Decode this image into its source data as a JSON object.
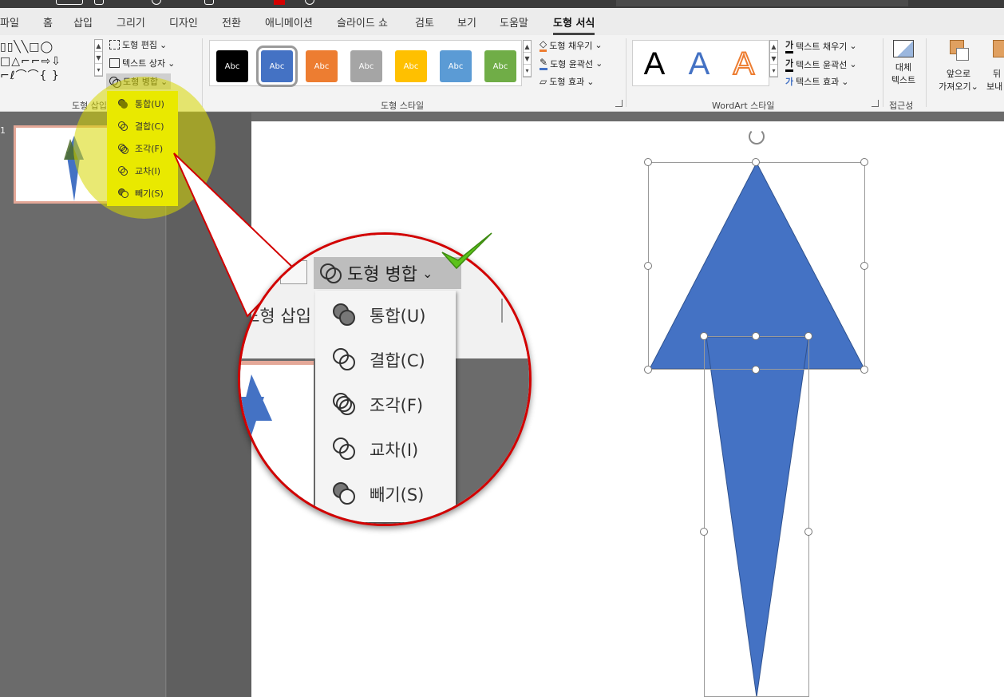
{
  "tabs": [
    "파일",
    "홈",
    "삽입",
    "그리기",
    "디자인",
    "전환",
    "애니메이션",
    "슬라이드 쇼",
    "검토",
    "보기",
    "도움말",
    "도형 서식"
  ],
  "active_tab": "도형 서식",
  "ribbon": {
    "insert_shapes": {
      "label": "도형 삽입",
      "edit_shape": "도형 편집",
      "text_box": "텍스트 상자",
      "merge_shapes": "도형 병합"
    },
    "shape_styles": {
      "label": "도형 스타일",
      "chip_text": "Abc",
      "chip_colors": [
        "#000000",
        "#4472c4",
        "#ed7d31",
        "#a5a5a5",
        "#ffc000",
        "#5b9bd5",
        "#70ad47"
      ],
      "shape_fill": "도형 채우기",
      "shape_outline": "도형 윤곽선",
      "shape_effects": "도형 효과"
    },
    "wordart": {
      "label": "WordArt 스타일",
      "letters": [
        "A",
        "A",
        "A"
      ],
      "text_fill": "텍스트 채우기",
      "text_outline": "텍스트 윤곽선",
      "text_effects": "텍스트 효과",
      "fill_glyph": "가",
      "outline_glyph": "가",
      "effects_glyph": "가"
    },
    "accessibility": {
      "label": "접근성",
      "alt_text_line1": "대체",
      "alt_text_line2": "텍스트"
    },
    "arrange": {
      "bring_forward_line1": "앞으로",
      "bring_forward_line2": "가져오기",
      "send_backward_line1": "뒤",
      "send_backward_line2": "보내"
    }
  },
  "merge_menu": [
    {
      "label": "통합",
      "key": "(U)"
    },
    {
      "label": "결합",
      "key": "(C)"
    },
    {
      "label": "조각",
      "key": "(F)"
    },
    {
      "label": "교차",
      "key": "(I)"
    },
    {
      "label": "빼기",
      "key": "(S)"
    }
  ],
  "slide_number": "1",
  "colors": {
    "shape_blue": "#4472c4",
    "highlight_yellow": "#e9e900",
    "magnifier_border": "#d20000",
    "check_green": "#5cc21a"
  }
}
